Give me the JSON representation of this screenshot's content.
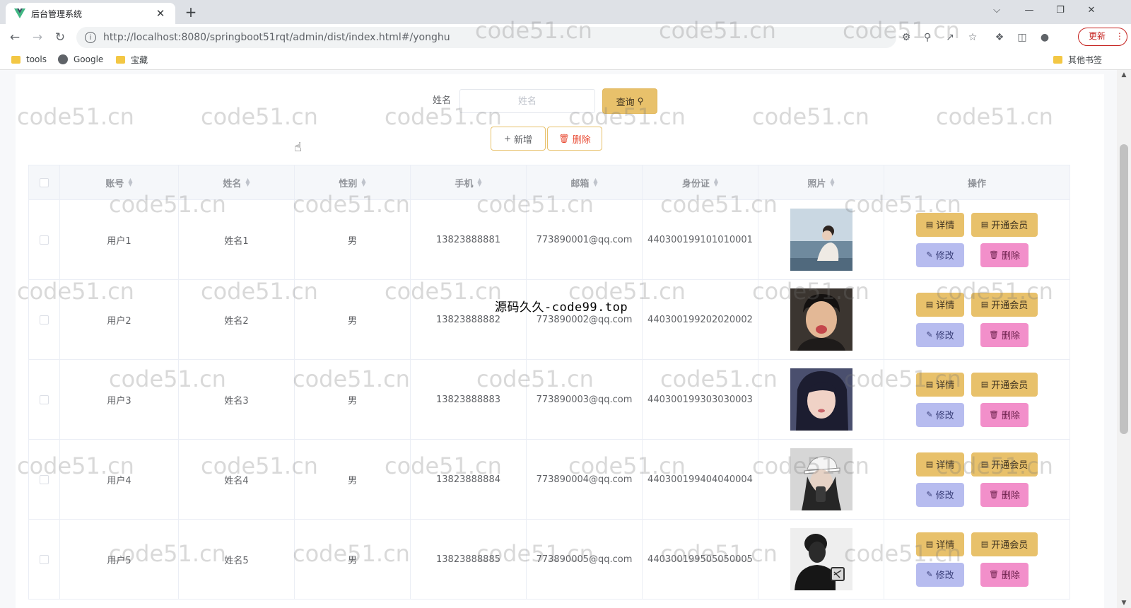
{
  "browser": {
    "tab_title": "后台管理系统",
    "tab_close": "✕",
    "new_tab": "+",
    "url": "http://localhost:8080/springboot51rqt/admin/dist/index.html#/yonghu",
    "update_label": "更新",
    "win_minimize": "—",
    "win_restore": "❐",
    "win_close": "✕",
    "win_dropdown": "⌵",
    "bookmarks": [
      "tools",
      "Google",
      "宝藏"
    ],
    "other_bookmarks": "其他书签"
  },
  "search": {
    "label": "姓名",
    "placeholder": "姓名",
    "value": "",
    "query_label": "查询"
  },
  "actions": {
    "add_label": "新增",
    "delete_label": "删除"
  },
  "table": {
    "headers": [
      "账号",
      "姓名",
      "性别",
      "手机",
      "邮箱",
      "身份证",
      "照片",
      "操作"
    ],
    "rows": [
      {
        "account": "用户1",
        "name": "姓名1",
        "gender": "男",
        "phone": "13823888881",
        "email": "773890001@qq.com",
        "id_card": "440300199101010001"
      },
      {
        "account": "用户2",
        "name": "姓名2",
        "gender": "男",
        "phone": "13823888882",
        "email": "773890002@qq.com",
        "id_card": "440300199202020002"
      },
      {
        "account": "用户3",
        "name": "姓名3",
        "gender": "男",
        "phone": "13823888883",
        "email": "773890003@qq.com",
        "id_card": "440300199303030003"
      },
      {
        "account": "用户4",
        "name": "姓名4",
        "gender": "男",
        "phone": "13823888884",
        "email": "773890004@qq.com",
        "id_card": "440300199404040004"
      },
      {
        "account": "用户5",
        "name": "姓名5",
        "gender": "男",
        "phone": "13823888885",
        "email": "773890005@qq.com",
        "id_card": "440300199505050005"
      }
    ],
    "row_actions": {
      "detail": "详情",
      "vip": "开通会员",
      "edit": "修改",
      "delete": "删除"
    }
  },
  "watermark_text": "code51.cn",
  "center_watermark": "源码久久-code99.top",
  "colors": {
    "primary": "#e8c16b",
    "edit": "#b7bcef",
    "delete": "#f28fca",
    "danger_text": "#e8472f"
  }
}
